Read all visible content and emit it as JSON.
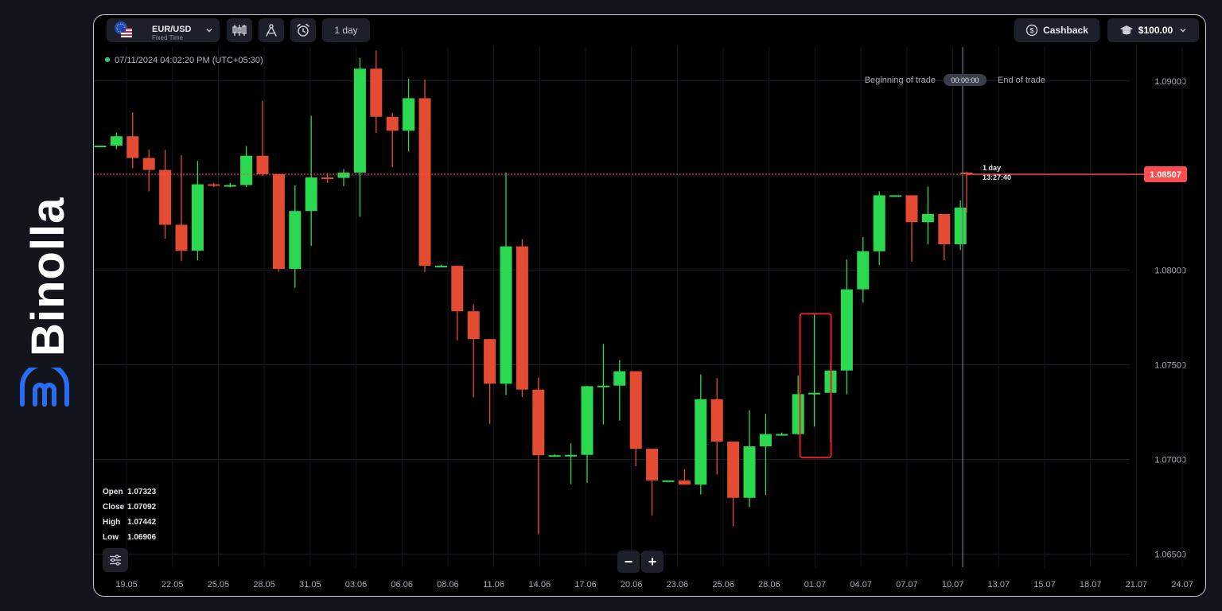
{
  "brand": {
    "name": "Binolla"
  },
  "toolbar": {
    "asset": "EUR/USD",
    "asset_mode": "Fixed Time",
    "timeframe": "1 day",
    "cashback_label": "Cashback",
    "balance": "$100.00"
  },
  "chart_header": {
    "datetime": "07/11/2024 04:02:20 PM",
    "timezone": "(UTC+05:30)",
    "beginning_label": "Beginning of trade",
    "timer": "00:00:00",
    "end_label": "End of trade"
  },
  "ohlc": {
    "open_label": "Open",
    "open": "1.07323",
    "close_label": "Close",
    "close": "1.07092",
    "high_label": "High",
    "high": "1.07442",
    "low_label": "Low",
    "low": "1.06906"
  },
  "price_tag": {
    "value": "1.08507",
    "expiry_label": "1 day",
    "expiry_time": "13:27:40"
  },
  "zoom": {
    "minus": "−",
    "plus": "+"
  },
  "colors": {
    "up": "#2bd951",
    "down": "#e34b33",
    "price_line": "#ff4d4f",
    "highlight_box": "#e0201f"
  },
  "chart_data": {
    "type": "candlestick",
    "symbol": "EUR/USD",
    "ylim": [
      1.0643,
      1.0918
    ],
    "y_ticks": [
      "1.09000",
      "1.08500",
      "1.08000",
      "1.07500",
      "1.07000",
      "1.06500"
    ],
    "x_ticks": [
      "19.05",
      "22.05",
      "25.05",
      "28.05",
      "31.05",
      "03.06",
      "06.06",
      "08.06",
      "11.06",
      "14.06",
      "17.06",
      "20.06",
      "23.06",
      "25.06",
      "28.06",
      "01.07",
      "04.07",
      "07.07",
      "10.07",
      "13.07",
      "15.07",
      "18.07",
      "21.07",
      "24.07"
    ],
    "current_price": 1.08507,
    "highlighted_candles": [
      1.07352,
      1.07352
    ],
    "candles": [
      {
        "o": 1.08658,
        "c": 1.08658,
        "h": 1.08658,
        "l": 1.08658
      },
      {
        "o": 1.08658,
        "c": 1.08708,
        "h": 1.08727,
        "l": 1.0864
      },
      {
        "o": 1.08708,
        "c": 1.08593,
        "h": 1.08834,
        "l": 1.08539
      },
      {
        "o": 1.08593,
        "c": 1.0853,
        "h": 1.08637,
        "l": 1.08417
      },
      {
        "o": 1.0853,
        "c": 1.0824,
        "h": 1.08636,
        "l": 1.08167
      },
      {
        "o": 1.0824,
        "c": 1.08103,
        "h": 1.08608,
        "l": 1.08048
      },
      {
        "o": 1.08103,
        "c": 1.08454,
        "h": 1.08578,
        "l": 1.08052
      },
      {
        "o": 1.08454,
        "c": 1.0845,
        "h": 1.08461,
        "l": 1.08439
      },
      {
        "o": 1.0845,
        "c": 1.0845,
        "h": 1.08461,
        "l": 1.08439
      },
      {
        "o": 1.0845,
        "c": 1.08605,
        "h": 1.08656,
        "l": 1.08439
      },
      {
        "o": 1.08605,
        "c": 1.08508,
        "h": 1.08895,
        "l": 1.08497
      },
      {
        "o": 1.08508,
        "c": 1.08007,
        "h": 1.08508,
        "l": 1.07992
      },
      {
        "o": 1.08007,
        "c": 1.08313,
        "h": 1.08449,
        "l": 1.07907
      },
      {
        "o": 1.08313,
        "c": 1.0849,
        "h": 1.08816,
        "l": 1.08128
      },
      {
        "o": 1.0849,
        "c": 1.08488,
        "h": 1.08513,
        "l": 1.08461
      },
      {
        "o": 1.08488,
        "c": 1.08516,
        "h": 1.08534,
        "l": 1.08444
      },
      {
        "o": 1.08516,
        "c": 1.09065,
        "h": 1.09122,
        "l": 1.08282
      },
      {
        "o": 1.09065,
        "c": 1.08811,
        "h": 1.09161,
        "l": 1.08726
      },
      {
        "o": 1.08811,
        "c": 1.08737,
        "h": 1.08831,
        "l": 1.08544
      },
      {
        "o": 1.08737,
        "c": 1.08909,
        "h": 1.09012,
        "l": 1.08627
      },
      {
        "o": 1.08909,
        "c": 1.08023,
        "h": 1.09009,
        "l": 1.07991
      },
      {
        "o": 1.08023,
        "c": 1.08023,
        "h": 1.08029,
        "l": 1.08018
      },
      {
        "o": 1.08023,
        "c": 1.07783,
        "h": 1.08025,
        "l": 1.07629
      },
      {
        "o": 1.07783,
        "c": 1.07636,
        "h": 1.0782,
        "l": 1.07328
      },
      {
        "o": 1.07636,
        "c": 1.074,
        "h": 1.07636,
        "l": 1.07187
      },
      {
        "o": 1.074,
        "c": 1.08126,
        "h": 1.08517,
        "l": 1.0734
      },
      {
        "o": 1.08126,
        "c": 1.07369,
        "h": 1.08164,
        "l": 1.0733
      },
      {
        "o": 1.07369,
        "c": 1.07022,
        "h": 1.07433,
        "l": 1.06604
      },
      {
        "o": 1.07022,
        "c": 1.07022,
        "h": 1.07027,
        "l": 1.07016
      },
      {
        "o": 1.07022,
        "c": 1.07024,
        "h": 1.07085,
        "l": 1.06869
      },
      {
        "o": 1.07024,
        "c": 1.07387,
        "h": 1.07389,
        "l": 1.06876
      },
      {
        "o": 1.07387,
        "c": 1.0739,
        "h": 1.07611,
        "l": 1.07185
      },
      {
        "o": 1.0739,
        "c": 1.07466,
        "h": 1.07525,
        "l": 1.07205
      },
      {
        "o": 1.07466,
        "c": 1.07056,
        "h": 1.07466,
        "l": 1.06964
      },
      {
        "o": 1.07056,
        "c": 1.06889,
        "h": 1.07056,
        "l": 1.06703
      },
      {
        "o": 1.06889,
        "c": 1.06889,
        "h": 1.06889,
        "l": 1.06889
      },
      {
        "o": 1.06889,
        "c": 1.06867,
        "h": 1.06948,
        "l": 1.06867
      },
      {
        "o": 1.06867,
        "c": 1.07318,
        "h": 1.07449,
        "l": 1.06814
      },
      {
        "o": 1.07318,
        "c": 1.07094,
        "h": 1.0743,
        "l": 1.0692
      },
      {
        "o": 1.07094,
        "c": 1.06797,
        "h": 1.07094,
        "l": 1.06646
      },
      {
        "o": 1.06797,
        "c": 1.07069,
        "h": 1.0726,
        "l": 1.06748
      },
      {
        "o": 1.07069,
        "c": 1.07134,
        "h": 1.07242,
        "l": 1.06812
      },
      {
        "o": 1.07134,
        "c": 1.07134,
        "h": 1.07142,
        "l": 1.07126
      },
      {
        "o": 1.07134,
        "c": 1.07345,
        "h": 1.07443,
        "l": 1.0713
      },
      {
        "o": 1.07352,
        "c": 1.07352,
        "h": 1.07766,
        "l": 1.07173
      },
      {
        "o": 1.07352,
        "c": 1.0747,
        "h": 1.0752,
        "l": 1.07092
      },
      {
        "o": 1.0747,
        "c": 1.07899,
        "h": 1.08057,
        "l": 1.07344
      },
      {
        "o": 1.07899,
        "c": 1.081,
        "h": 1.08175,
        "l": 1.07829
      },
      {
        "o": 1.081,
        "c": 1.08396,
        "h": 1.08418,
        "l": 1.08027
      },
      {
        "o": 1.08396,
        "c": 1.08396,
        "h": 1.08396,
        "l": 1.08396
      },
      {
        "o": 1.08396,
        "c": 1.08254,
        "h": 1.08396,
        "l": 1.08045
      },
      {
        "o": 1.08254,
        "c": 1.08297,
        "h": 1.08442,
        "l": 1.08136
      },
      {
        "o": 1.08297,
        "c": 1.08137,
        "h": 1.08297,
        "l": 1.08053
      },
      {
        "o": 1.08137,
        "c": 1.08331,
        "h": 1.08369,
        "l": 1.08106
      },
      {
        "o": 1.08516,
        "c": 1.08507,
        "h": 1.08521,
        "l": 1.08303
      }
    ]
  }
}
